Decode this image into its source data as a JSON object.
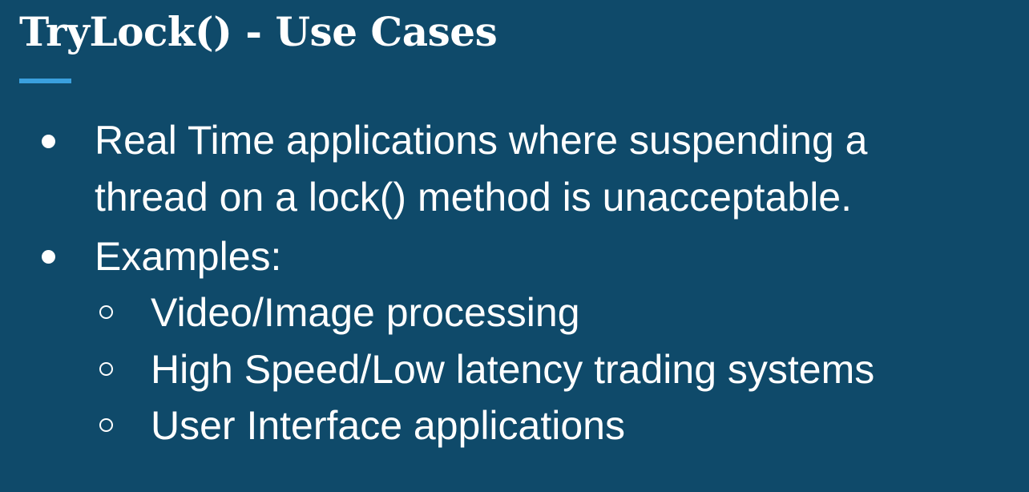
{
  "slide": {
    "title": "TryLock() - Use Cases",
    "accent_color": "#3aa0de",
    "background_color": "#0f4a6a",
    "bullets": [
      {
        "lines": [
          "Real Time applications where suspending a",
          "thread on a lock() method is unacceptable."
        ]
      },
      {
        "lines": [
          "Examples:"
        ],
        "subitems": [
          "Video/Image processing",
          "High Speed/Low latency trading systems",
          "User Interface applications"
        ]
      }
    ]
  }
}
